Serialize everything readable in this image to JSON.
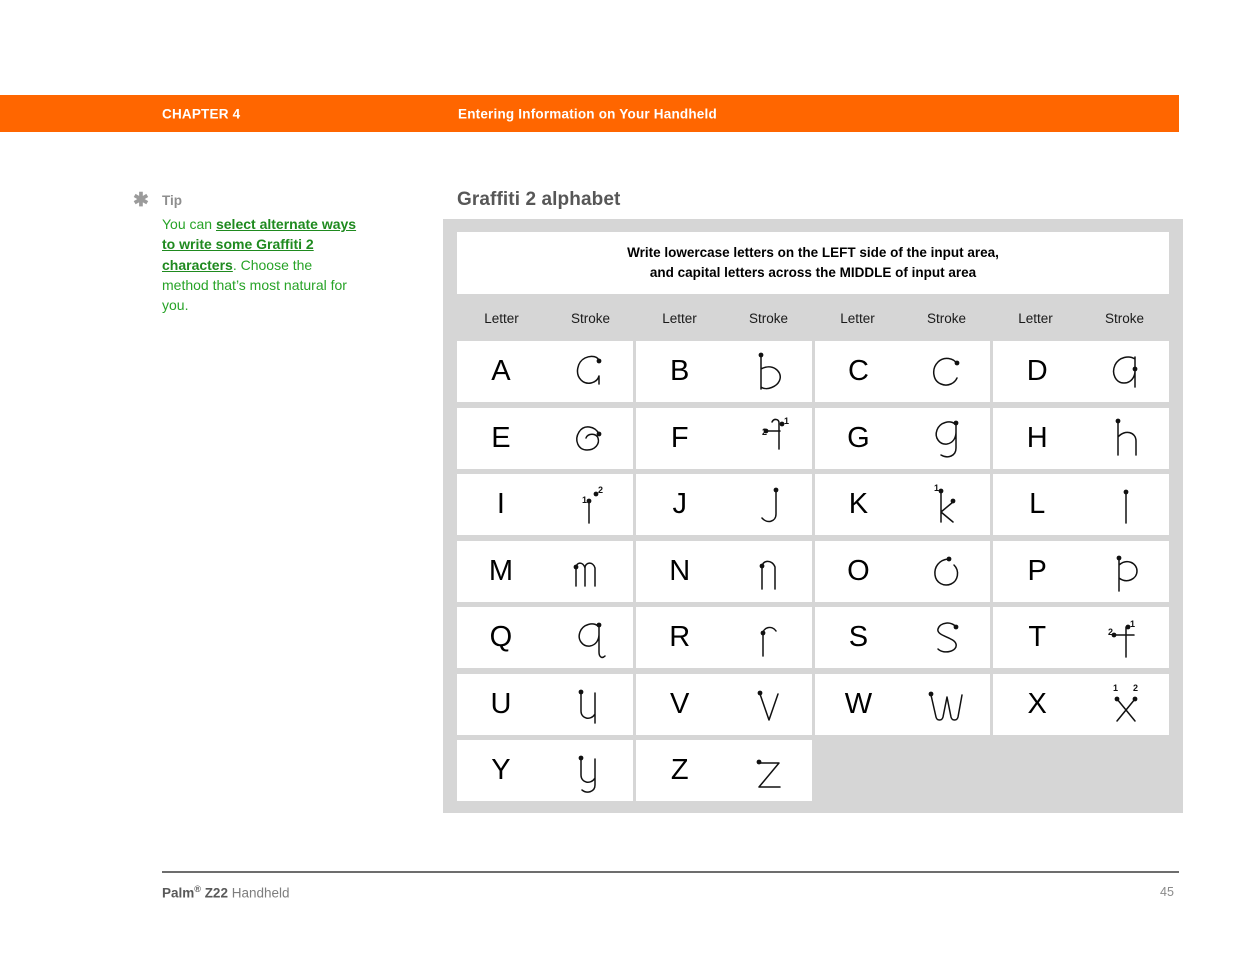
{
  "header": {
    "chapter_label": "CHAPTER 4",
    "chapter_title": "Entering Information on Your Handheld",
    "bar_color": "#FF6600",
    "text_color": "#FFFFFF"
  },
  "tip": {
    "icon": "asterisk-icon",
    "label": "Tip",
    "text_before": "You can ",
    "link_text": "select alternate ways to write some Graffiti 2 characters",
    "text_after": ". Choose the method that’s most natural for you.",
    "text_color": "#27A327",
    "link_color": "#1F8A1F"
  },
  "main": {
    "heading": "Graffiti 2 alphabet",
    "panel_bg": "#D6D6D6",
    "instruction": {
      "line1": "Write lowercase letters on the LEFT side of the input area,",
      "line2": "and capital letters across the MIDDLE of input area"
    },
    "column_headers": [
      "Letter",
      "Stroke",
      "Letter",
      "Stroke",
      "Letter",
      "Stroke",
      "Letter",
      "Stroke"
    ],
    "rows": [
      [
        {
          "letter": "A",
          "stroke": "stroke-a"
        },
        {
          "letter": "B",
          "stroke": "stroke-b"
        },
        {
          "letter": "C",
          "stroke": "stroke-c"
        },
        {
          "letter": "D",
          "stroke": "stroke-d"
        }
      ],
      [
        {
          "letter": "E",
          "stroke": "stroke-e"
        },
        {
          "letter": "F",
          "stroke": "stroke-f",
          "stroke_numbers": [
            "1",
            "2"
          ]
        },
        {
          "letter": "G",
          "stroke": "stroke-g"
        },
        {
          "letter": "H",
          "stroke": "stroke-h"
        }
      ],
      [
        {
          "letter": "I",
          "stroke": "stroke-i",
          "stroke_numbers": [
            "1",
            "2"
          ]
        },
        {
          "letter": "J",
          "stroke": "stroke-j"
        },
        {
          "letter": "K",
          "stroke": "stroke-k",
          "stroke_numbers": [
            "1"
          ]
        },
        {
          "letter": "L",
          "stroke": "stroke-l"
        }
      ],
      [
        {
          "letter": "M",
          "stroke": "stroke-m"
        },
        {
          "letter": "N",
          "stroke": "stroke-n"
        },
        {
          "letter": "O",
          "stroke": "stroke-o"
        },
        {
          "letter": "P",
          "stroke": "stroke-p"
        }
      ],
      [
        {
          "letter": "Q",
          "stroke": "stroke-q"
        },
        {
          "letter": "R",
          "stroke": "stroke-r"
        },
        {
          "letter": "S",
          "stroke": "stroke-s"
        },
        {
          "letter": "T",
          "stroke": "stroke-t",
          "stroke_numbers": [
            "1",
            "2"
          ]
        }
      ],
      [
        {
          "letter": "U",
          "stroke": "stroke-u"
        },
        {
          "letter": "V",
          "stroke": "stroke-v"
        },
        {
          "letter": "W",
          "stroke": "stroke-w"
        },
        {
          "letter": "X",
          "stroke": "stroke-x",
          "stroke_numbers": [
            "1",
            "2"
          ]
        }
      ],
      [
        {
          "letter": "Y",
          "stroke": "stroke-y"
        },
        {
          "letter": "Z",
          "stroke": "stroke-z"
        },
        {
          "letter": "",
          "stroke": ""
        },
        {
          "letter": "",
          "stroke": ""
        }
      ]
    ]
  },
  "footer": {
    "brand": "Palm",
    "registered_mark": "®",
    "model": "Z22",
    "product": " Handheld",
    "page_number": "45"
  }
}
